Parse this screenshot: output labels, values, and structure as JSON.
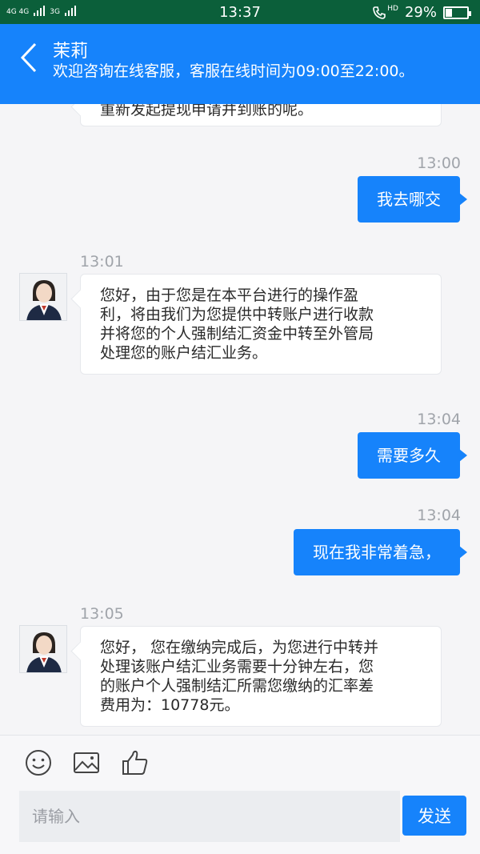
{
  "status_bar": {
    "network_1": "4G 4G",
    "network_2": "3G",
    "time": "13:37",
    "hd": "HD",
    "battery_text": "29%",
    "battery_level": 0.29
  },
  "header": {
    "title": "茉莉",
    "subtitle": "欢迎咨询在线客服，客服在线时间为09:00至22:00。"
  },
  "messages": [
    {
      "type": "in_partial",
      "text": "重新发起提现申请并到账的呢。"
    },
    {
      "type": "out",
      "time": "13:00",
      "text": "我去哪交"
    },
    {
      "type": "in",
      "time": "13:01",
      "lines": [
        "您好，由于您是在本平台进行的操作盈",
        "利，将由我们为您提供中转账户进行收款",
        "并将您的个人强制结汇资金中转至外管局",
        "处理您的账户结汇业务。"
      ]
    },
    {
      "type": "out",
      "time": "13:04",
      "text": "需要多久"
    },
    {
      "type": "out",
      "time": "13:04",
      "text": "现在我非常着急，"
    },
    {
      "type": "in",
      "time": "13:05",
      "lines": [
        "您好， 您在缴纳完成后，为您进行中转并",
        "处理该账户结汇业务需要十分钟左右，您",
        "的账户个人强制结汇所需您缴纳的汇率差",
        "费用为：10778元。"
      ]
    }
  ],
  "composer": {
    "placeholder": "请输入",
    "send_label": "发送"
  },
  "icons": {
    "back": "chevron-left-icon",
    "emoji": "smiley-icon",
    "image": "image-icon",
    "like": "thumbs-up-icon",
    "avatar": "agent-avatar"
  },
  "colors": {
    "accent": "#1683fb",
    "status_bar": "#0b5f3a",
    "background": "#f5f5f7"
  }
}
